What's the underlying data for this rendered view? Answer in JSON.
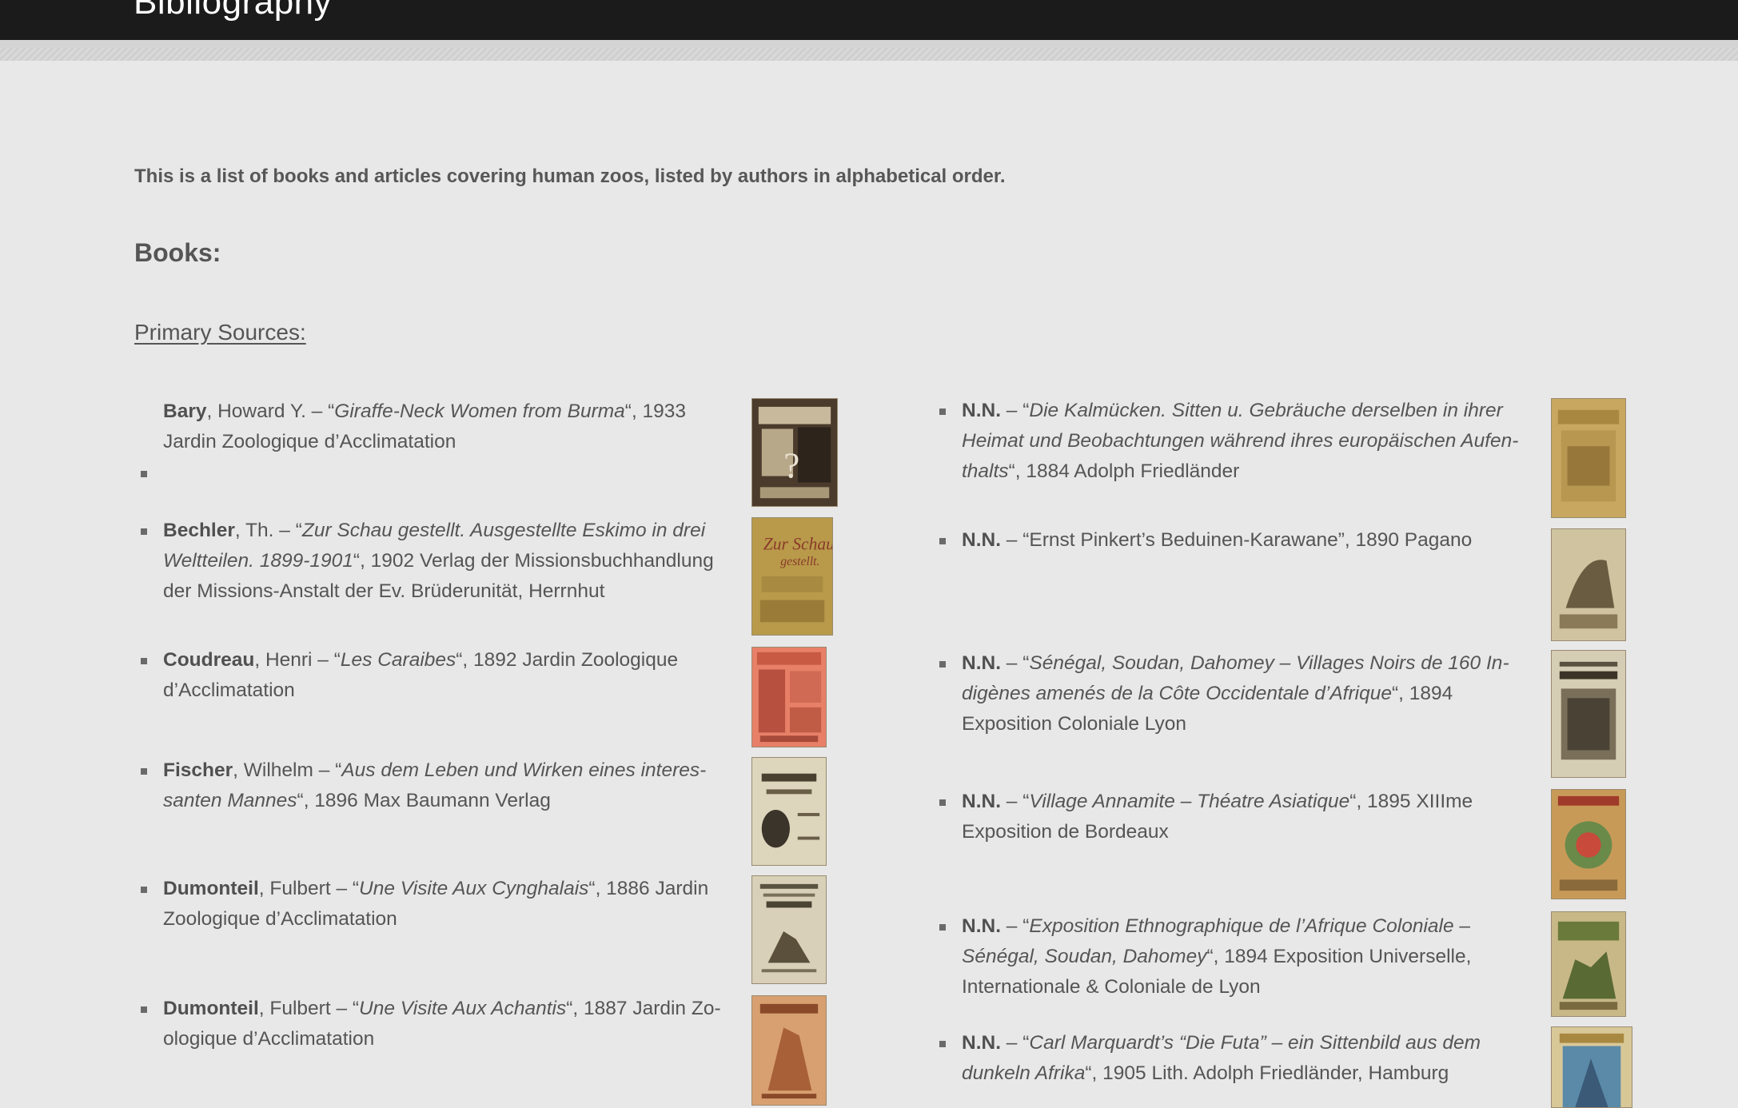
{
  "header": {
    "site_title": "Bibliography"
  },
  "intro": "This is a list of books and articles covering human zoos, listed by authors in alphabetical order.",
  "books_heading": "Books:",
  "primary_sources_heading": "Primary Sources:",
  "left_entries": [
    {
      "author": "Bary",
      "rest_a": ", Howard Y. – “",
      "title": "Giraffe-Neck Women from Burma",
      "rest_b": "“, 1933 Jardin Zoologique d’Acclimatation"
    },
    {
      "author": "Bechler",
      "rest_a": ", Th. – “",
      "title": "Zur Schau gestellt. Ausgestellte Eskimo in drei Weltteilen. 1899-1901",
      "rest_b": "“, 1902 Verlag der Missionsbuchhandlung der Missions-Anstalt der Ev. Brüderunität, Herrnhut"
    },
    {
      "author": "Coudreau",
      "rest_a": ", Henri – “",
      "title": "Les Caraibes",
      "rest_b": "“, 1892 Jardin Zoologique d’Acclimatation"
    },
    {
      "author": "Fischer",
      "rest_a": ", Wilhelm – “",
      "title": "Aus dem Leben und Wirken eines interes­santen Mannes",
      "rest_b": "“, 1896 Max Baumann Verlag"
    },
    {
      "author": "Dumonteil",
      "rest_a": ", Fulbert – “",
      "title": "Une Visite Aux Cynghalais",
      "rest_b": "“, 1886 Jardin Zoologique d’Acclimatation"
    },
    {
      "author": "Dumonteil",
      "rest_a": ", Fulbert – “",
      "title": "Une Visite Aux Achantis",
      "rest_b": "“, 1887 Jardin Zo­ologique d’Acclimatation"
    }
  ],
  "right_entries": [
    {
      "author": "N.N.",
      "rest_a": " – “",
      "title": "Die Kalmücken. Sitten u. Gebräuche derselben in ihrer Heimat und Beobachtungen während ihres europäischen Aufen­thalts",
      "rest_b": "“, 1884 Adolph Friedländer"
    },
    {
      "author": "N.N.",
      "rest_a": " – “Ernst Pinkert’s Beduinen-Karawane”, 1890 Pagano",
      "title": "",
      "rest_b": ""
    },
    {
      "author": "N.N.",
      "rest_a": " – “",
      "title": "Sénégal, Soudan, Dahomey – Villages Noirs de 160 In­digènes amenés de la Côte Occidentale d’Afrique",
      "rest_b": "“, 1894 Exposi­tion Coloniale Lyon"
    },
    {
      "author": "N.N.",
      "rest_a": " – “",
      "title": "Village Annamite – Théatre Asiatique",
      "rest_b": "“, 1895 XIIIme Expo­sition de Bordeaux"
    },
    {
      "author": "N.N.",
      "rest_a": " – “",
      "title": "Exposition Ethnographique de l’Afrique Coloniale – Séné­gal, Soudan, Dahomey",
      "rest_b": "“, 1894 Exposition Universelle,  Interna­tionale & Coloniale de Lyon"
    },
    {
      "author": "N.N.",
      "rest_a": " – “",
      "title": "Carl Marquardt’s “Die Futa” – ein Sittenbild aus dem dunkeln Afrika",
      "rest_b": "“, 1905 Lith. Adolph Friedländer, Hamburg"
    }
  ],
  "colors": {
    "background": "#e8e8e8",
    "header_bar": "#1b1b1b",
    "text": "#555555"
  }
}
